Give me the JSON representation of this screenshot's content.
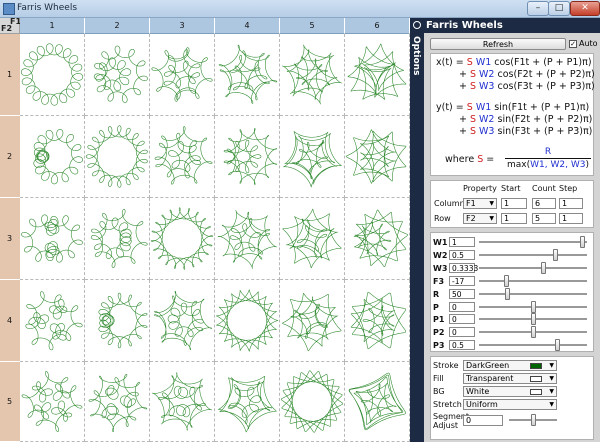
{
  "window": {
    "title": "Farris Wheels",
    "min_glyph": "–",
    "max_glyph": "□",
    "close_glyph": "✕"
  },
  "grid": {
    "corner_col_label": "F1",
    "corner_row_label": "F2",
    "columns": [
      "1",
      "2",
      "3",
      "4",
      "5",
      "6"
    ],
    "rows": [
      "1",
      "2",
      "3",
      "4",
      "5"
    ],
    "stroke_color": "#2f8a2f"
  },
  "panel": {
    "title": "Farris Wheels",
    "vertical_label": "Options",
    "refresh_label": "Refresh",
    "auto_label": "Auto",
    "auto_checked": "✓",
    "formula": {
      "x1": [
        "x(t) = ",
        "S",
        " W1",
        " cos(F1t + (P + P1)π)"
      ],
      "x2": [
        "+ ",
        "S",
        " W2",
        " cos(F2t + (P + P2)π)"
      ],
      "x3": [
        "+ ",
        "S",
        " W3",
        " cos(F3t + (P + P3)π)"
      ],
      "y1": [
        "y(t) = ",
        "S",
        " W1",
        " sin(F1t + (P + P1)π)"
      ],
      "y2": [
        "+ ",
        "S",
        " W2",
        " sin(F2t + (P + P2)π)"
      ],
      "y3": [
        "+ ",
        "S",
        " W3",
        " sin(F3t + (P + P3)π)"
      ],
      "where": "where",
      "s": "S",
      "eq": "=",
      "num": "R",
      "den_pre": "max(",
      "den_vars": "W1, W2, W3",
      "den_post": ")"
    },
    "range": {
      "headers": [
        "Property",
        "Start",
        "Count",
        "Step"
      ],
      "rows": [
        {
          "label": "Column",
          "property": "F1",
          "start": "1",
          "count": "6",
          "step": "1"
        },
        {
          "label": "Row",
          "property": "F2",
          "start": "1",
          "count": "5",
          "step": "1"
        }
      ]
    },
    "params": [
      {
        "label": "W1",
        "value": "1",
        "level": 0.98
      },
      {
        "label": "W2",
        "value": "0.5",
        "level": 0.72
      },
      {
        "label": "W3",
        "value": "0.3333",
        "level": 0.6
      },
      {
        "label": "F3",
        "value": "-17",
        "level": 0.24
      },
      {
        "label": "R",
        "value": "50",
        "level": 0.25
      },
      {
        "label": "P",
        "value": "0",
        "level": 0.5
      },
      {
        "label": "P1",
        "value": "0",
        "level": 0.5
      },
      {
        "label": "P2",
        "value": "0",
        "level": 0.5
      },
      {
        "label": "P3",
        "value": "0.5",
        "level": 0.74
      }
    ],
    "appearance": [
      {
        "label": "Stroke",
        "value": "DarkGreen",
        "swatch": "#006400"
      },
      {
        "label": "Fill",
        "value": "Transparent",
        "swatch": "#ffffff"
      },
      {
        "label": "BG",
        "value": "White",
        "swatch": "#ffffff"
      },
      {
        "label": "Stretch",
        "value": "Uniform"
      }
    ],
    "segment": {
      "label1": "Segment",
      "label2": "Adjust",
      "value": "0",
      "level": 0.5
    }
  }
}
